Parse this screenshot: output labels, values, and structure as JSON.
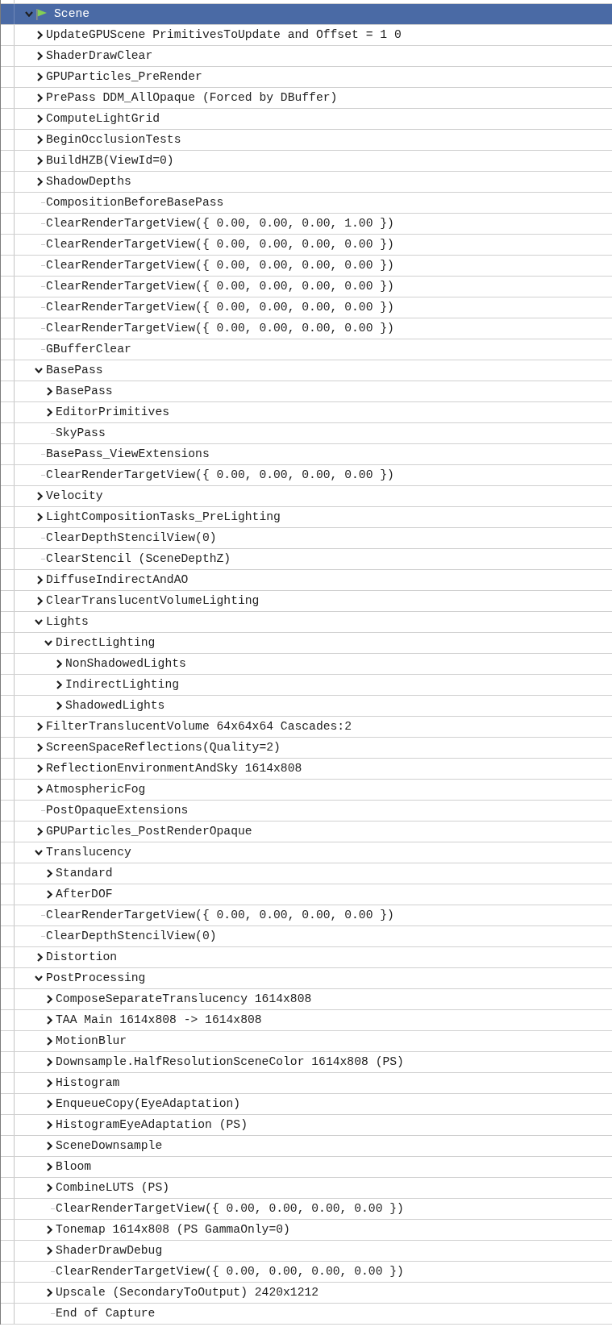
{
  "tree": [
    {
      "label": "Scene",
      "kind": "marker",
      "expanded": true,
      "selected": true,
      "children": [
        {
          "label": "UpdateGPUScene PrimitivesToUpdate and Offset = 1 0",
          "kind": "group",
          "expanded": false,
          "selected": false
        },
        {
          "label": "ShaderDrawClear",
          "kind": "group",
          "expanded": false,
          "selected": false
        },
        {
          "label": "GPUParticles_PreRender",
          "kind": "group",
          "expanded": false,
          "selected": false
        },
        {
          "label": "PrePass DDM_AllOpaque (Forced by DBuffer)",
          "kind": "group",
          "expanded": false,
          "selected": false
        },
        {
          "label": "ComputeLightGrid",
          "kind": "group",
          "expanded": false,
          "selected": false
        },
        {
          "label": "BeginOcclusionTests",
          "kind": "group",
          "expanded": false,
          "selected": false
        },
        {
          "label": "BuildHZB(ViewId=0)",
          "kind": "group",
          "expanded": false,
          "selected": false
        },
        {
          "label": "ShadowDepths",
          "kind": "group",
          "expanded": false,
          "selected": false
        },
        {
          "label": "CompositionBeforeBasePass",
          "kind": "event",
          "selected": false
        },
        {
          "label": "ClearRenderTargetView({ 0.00, 0.00, 0.00, 1.00 })",
          "kind": "event",
          "selected": false
        },
        {
          "label": "ClearRenderTargetView({ 0.00, 0.00, 0.00, 0.00 })",
          "kind": "event",
          "selected": false
        },
        {
          "label": "ClearRenderTargetView({ 0.00, 0.00, 0.00, 0.00 })",
          "kind": "event",
          "selected": false
        },
        {
          "label": "ClearRenderTargetView({ 0.00, 0.00, 0.00, 0.00 })",
          "kind": "event",
          "selected": false
        },
        {
          "label": "ClearRenderTargetView({ 0.00, 0.00, 0.00, 0.00 })",
          "kind": "event",
          "selected": false
        },
        {
          "label": "ClearRenderTargetView({ 0.00, 0.00, 0.00, 0.00 })",
          "kind": "event",
          "selected": false
        },
        {
          "label": "GBufferClear",
          "kind": "event",
          "selected": false
        },
        {
          "label": "BasePass",
          "kind": "group",
          "expanded": true,
          "selected": false,
          "children": [
            {
              "label": "BasePass",
              "kind": "group",
              "expanded": false,
              "selected": false
            },
            {
              "label": "EditorPrimitives",
              "kind": "group",
              "expanded": false,
              "selected": false
            },
            {
              "label": "SkyPass",
              "kind": "event",
              "selected": false
            }
          ]
        },
        {
          "label": "BasePass_ViewExtensions",
          "kind": "event",
          "selected": false
        },
        {
          "label": "ClearRenderTargetView({ 0.00, 0.00, 0.00, 0.00 })",
          "kind": "event",
          "selected": false
        },
        {
          "label": "Velocity",
          "kind": "group",
          "expanded": false,
          "selected": false
        },
        {
          "label": "LightCompositionTasks_PreLighting",
          "kind": "group",
          "expanded": false,
          "selected": false
        },
        {
          "label": "ClearDepthStencilView(0)",
          "kind": "event",
          "selected": false
        },
        {
          "label": "ClearStencil (SceneDepthZ)",
          "kind": "event",
          "selected": false
        },
        {
          "label": "DiffuseIndirectAndAO",
          "kind": "group",
          "expanded": false,
          "selected": false
        },
        {
          "label": "ClearTranslucentVolumeLighting",
          "kind": "group",
          "expanded": false,
          "selected": false
        },
        {
          "label": "Lights",
          "kind": "group",
          "expanded": true,
          "selected": false,
          "children": [
            {
              "label": "DirectLighting",
              "kind": "group",
              "expanded": true,
              "selected": false,
              "children": [
                {
                  "label": "NonShadowedLights",
                  "kind": "group",
                  "expanded": false,
                  "selected": false
                },
                {
                  "label": "IndirectLighting",
                  "kind": "group",
                  "expanded": false,
                  "selected": false
                },
                {
                  "label": "ShadowedLights",
                  "kind": "group",
                  "expanded": false,
                  "selected": false
                }
              ]
            }
          ]
        },
        {
          "label": "FilterTranslucentVolume 64x64x64 Cascades:2",
          "kind": "group",
          "expanded": false,
          "selected": false
        },
        {
          "label": "ScreenSpaceReflections(Quality=2)",
          "kind": "group",
          "expanded": false,
          "selected": false
        },
        {
          "label": "ReflectionEnvironmentAndSky 1614x808",
          "kind": "group",
          "expanded": false,
          "selected": false
        },
        {
          "label": "AtmosphericFog",
          "kind": "group",
          "expanded": false,
          "selected": false
        },
        {
          "label": "PostOpaqueExtensions",
          "kind": "event",
          "selected": false
        },
        {
          "label": "GPUParticles_PostRenderOpaque",
          "kind": "group",
          "expanded": false,
          "selected": false
        },
        {
          "label": "Translucency",
          "kind": "group",
          "expanded": true,
          "selected": false,
          "children": [
            {
              "label": "Standard",
              "kind": "group",
              "expanded": false,
              "selected": false
            },
            {
              "label": "AfterDOF",
              "kind": "group",
              "expanded": false,
              "selected": false
            }
          ]
        },
        {
          "label": "ClearRenderTargetView({ 0.00, 0.00, 0.00, 0.00 })",
          "kind": "event",
          "selected": false
        },
        {
          "label": "ClearDepthStencilView(0)",
          "kind": "event",
          "selected": false
        },
        {
          "label": "Distortion",
          "kind": "group",
          "expanded": false,
          "selected": false
        },
        {
          "label": "PostProcessing",
          "kind": "group",
          "expanded": true,
          "selected": false,
          "children": [
            {
              "label": "ComposeSeparateTranslucency 1614x808",
              "kind": "group",
              "expanded": false,
              "selected": false
            },
            {
              "label": "TAA Main 1614x808 -> 1614x808",
              "kind": "group",
              "expanded": false,
              "selected": false
            },
            {
              "label": "MotionBlur",
              "kind": "group",
              "expanded": false,
              "selected": false
            },
            {
              "label": "Downsample.HalfResolutionSceneColor 1614x808 (PS)",
              "kind": "group",
              "expanded": false,
              "selected": false
            },
            {
              "label": "Histogram",
              "kind": "group",
              "expanded": false,
              "selected": false
            },
            {
              "label": "EnqueueCopy(EyeAdaptation)",
              "kind": "group",
              "expanded": false,
              "selected": false
            },
            {
              "label": "HistogramEyeAdaptation (PS)",
              "kind": "group",
              "expanded": false,
              "selected": false
            },
            {
              "label": "SceneDownsample",
              "kind": "group",
              "expanded": false,
              "selected": false
            },
            {
              "label": "Bloom",
              "kind": "group",
              "expanded": false,
              "selected": false
            },
            {
              "label": "CombineLUTS (PS)",
              "kind": "group",
              "expanded": false,
              "selected": false
            },
            {
              "label": "ClearRenderTargetView({ 0.00, 0.00, 0.00, 0.00 })",
              "kind": "event",
              "selected": false
            },
            {
              "label": "Tonemap 1614x808 (PS GammaOnly=0)",
              "kind": "group",
              "expanded": false,
              "selected": false
            },
            {
              "label": "ShaderDrawDebug",
              "kind": "group",
              "expanded": false,
              "selected": false
            },
            {
              "label": "ClearRenderTargetView({ 0.00, 0.00, 0.00, 0.00 })",
              "kind": "event",
              "selected": false
            },
            {
              "label": "Upscale (SecondaryToOutput) 2420x1212",
              "kind": "group",
              "expanded": false,
              "selected": false
            },
            {
              "label": "End of Capture",
              "kind": "event",
              "selected": false
            }
          ]
        }
      ]
    }
  ]
}
